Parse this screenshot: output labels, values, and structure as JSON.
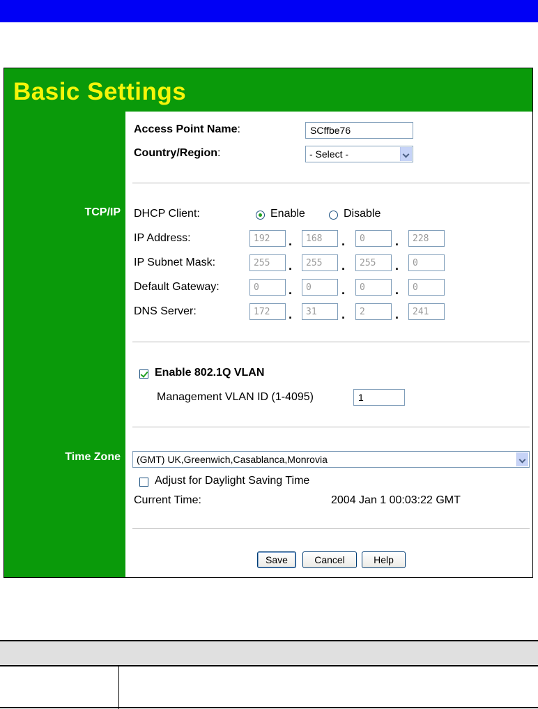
{
  "page": {
    "title": "Basic Settings"
  },
  "general": {
    "ap_name_label": "Access Point Name",
    "ap_name_value": "SCffbe76",
    "country_label": "Country/Region",
    "country_value": "- Select -"
  },
  "tcpip": {
    "section_label": "TCP/IP",
    "dhcp_label": "DHCP Client:",
    "dhcp_enable": "Enable",
    "dhcp_disable": "Disable",
    "dhcp_selected": "Enable",
    "ip_label": "IP Address:",
    "ip": [
      "192",
      "168",
      "0",
      "228"
    ],
    "mask_label": "IP Subnet Mask:",
    "mask": [
      "255",
      "255",
      "255",
      "0"
    ],
    "gateway_label": "Default Gateway:",
    "gateway": [
      "0",
      "0",
      "0",
      "0"
    ],
    "dns_label": "DNS Server:",
    "dns": [
      "172",
      "31",
      "2",
      "241"
    ]
  },
  "vlan": {
    "enable_label": "Enable 802.1Q VLAN",
    "enabled": true,
    "mgmt_label": "Management VLAN ID (1-4095)",
    "mgmt_value": "1"
  },
  "timezone": {
    "section_label": "Time Zone",
    "value": "(GMT) UK,Greenwich,Casablanca,Monrovia",
    "dst_label": "Adjust for Daylight Saving Time",
    "dst_checked": false,
    "current_label": "Current Time:",
    "current_value": "2004 Jan 1 00:03:22 GMT"
  },
  "buttons": {
    "save": "Save",
    "cancel": "Cancel",
    "help": "Help"
  },
  "colors": {
    "header_blue": "#0000f5",
    "panel_green": "#0a9a0a",
    "title_yellow": "#f5f50a"
  }
}
